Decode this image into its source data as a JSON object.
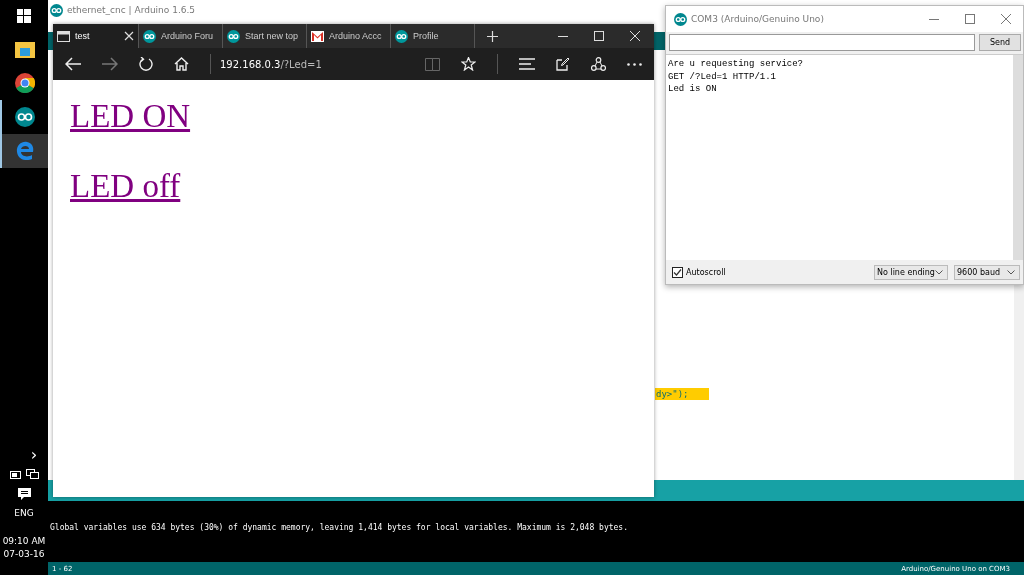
{
  "taskbar": {
    "apps": [
      {
        "kind": "explorer",
        "running": false,
        "selected": false
      },
      {
        "kind": "chrome",
        "running": false,
        "selected": false
      },
      {
        "kind": "arduino",
        "running": true,
        "selected": false
      },
      {
        "kind": "edge",
        "running": true,
        "selected": true
      }
    ],
    "tray": {
      "expand": "›",
      "language": "ENG",
      "time": "09:10 AM",
      "date": "07-03-16"
    }
  },
  "ide": {
    "title": "ethernet_cnc | Arduino 1.6.5",
    "code_fragment": "dy>\");",
    "console_lines": [
      "Global variables use 634 bytes (30%) of dynamic memory, leaving 1,414 bytes for local variables. Maximum is 2,048 bytes."
    ],
    "status": {
      "line": "1 - 62",
      "board": "Arduino/Genuino Uno on COM3"
    }
  },
  "browser": {
    "tabs": [
      {
        "kind": "page",
        "title": "test",
        "selected": true
      },
      {
        "kind": "arduino",
        "title": "Arduino Foru",
        "selected": false
      },
      {
        "kind": "arduino",
        "title": "Start new top",
        "selected": false
      },
      {
        "kind": "mail",
        "title": "Arduino Accc",
        "selected": false
      },
      {
        "kind": "arduino",
        "title": "Profile",
        "selected": false
      }
    ],
    "address": {
      "host": "192.168.0.3",
      "path": "/?Led=1"
    },
    "links": [
      "LED ON",
      "LED off"
    ]
  },
  "serial": {
    "title": "COM3 (Arduino/Genuino Uno)",
    "send": "Send",
    "output": [
      "Are u requesting service?",
      "GET /?Led=1 HTTP/1.1",
      "Led is ON"
    ],
    "autoscroll": {
      "label": "Autoscroll",
      "checked": true
    },
    "line_ending": "No line ending",
    "baud": "9600 baud"
  }
}
